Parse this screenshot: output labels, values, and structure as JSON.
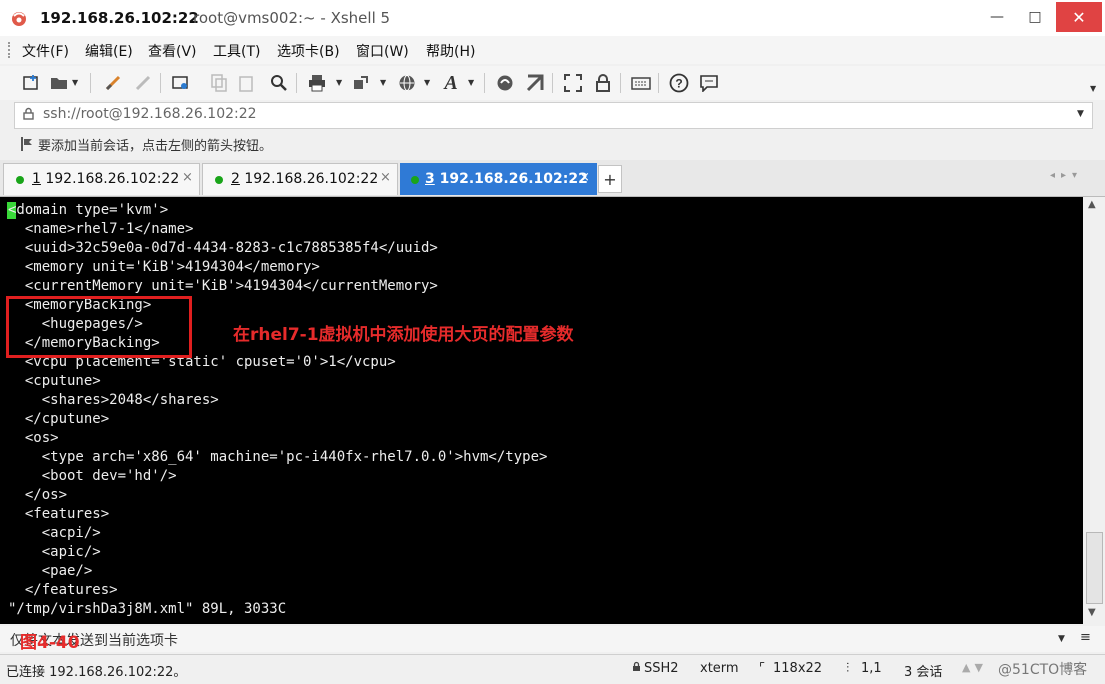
{
  "window": {
    "host": "192.168.26.102:22",
    "subtitle": "root@vms002:~ - Xshell 5",
    "controls": {
      "minimize": "—",
      "maximize": "□",
      "close": "✕"
    }
  },
  "menu": [
    "文件(F)",
    "编辑(E)",
    "查看(V)",
    "工具(T)",
    "选项卡(B)",
    "窗口(W)",
    "帮助(H)"
  ],
  "toolbar_icons": [
    "new-session-icon",
    "open-folder-icon",
    "connect-icon",
    "disconnect-icon",
    "properties-icon",
    "copy-icon",
    "paste-icon",
    "find-icon",
    "print-icon",
    "transfer-icon",
    "globe-icon",
    "font-icon",
    "xftp-icon",
    "xagent-icon",
    "fullscreen-icon",
    "lock-icon",
    "keyboard-icon",
    "help-icon",
    "chat-icon"
  ],
  "address": {
    "value": "ssh://root@192.168.26.102:22"
  },
  "hint": "要添加当前会话，点击左侧的箭头按钮。",
  "tabs": [
    {
      "num": "1",
      "label": " 192.168.26.102:22",
      "active": false
    },
    {
      "num": "2",
      "label": " 192.168.26.102:22",
      "active": false
    },
    {
      "num": "3",
      "label": " 192.168.26.102:22",
      "active": true
    }
  ],
  "tab_add": "+",
  "terminal": {
    "lines": [
      "<domain type='kvm'>",
      "  <name>rhel7-1</name>",
      "  <uuid>32c59e0a-0d7d-4434-8283-c1c7885385f4</uuid>",
      "  <memory unit='KiB'>4194304</memory>",
      "  <currentMemory unit='KiB'>4194304</currentMemory>",
      "  <memoryBacking>",
      "    <hugepages/>",
      "  </memoryBacking>",
      "  <vcpu placement='static' cpuset='0'>1</vcpu>",
      "  <cputune>",
      "    <shares>2048</shares>",
      "  </cputune>",
      "  <os>",
      "    <type arch='x86_64' machine='pc-i440fx-rhel7.0.0'>hvm</type>",
      "    <boot dev='hd'/>",
      "  </os>",
      "  <features>",
      "    <acpi/>",
      "    <apic/>",
      "    <pae/>",
      "  </features>",
      "\"/tmp/virshDa3j8M.xml\" 89L, 3033C"
    ],
    "annotation": "在rhel7-1虚拟机中添加使用大页的配置参数"
  },
  "sendbar": {
    "text": "仅将文本发送到当前选项卡",
    "figure_label": "图4-40"
  },
  "status": {
    "connected": "已连接 192.168.26.102:22。",
    "protocol": "SSH2",
    "term": "xterm",
    "size": "118x22",
    "pos": "1,1",
    "sessions": "3 会话",
    "watermark": "@51CTO博客"
  },
  "colors": {
    "accent": "#2f7ad6",
    "terminal_bg": "#000000",
    "annotation": "#e62b2b",
    "cursor": "#39d839"
  }
}
